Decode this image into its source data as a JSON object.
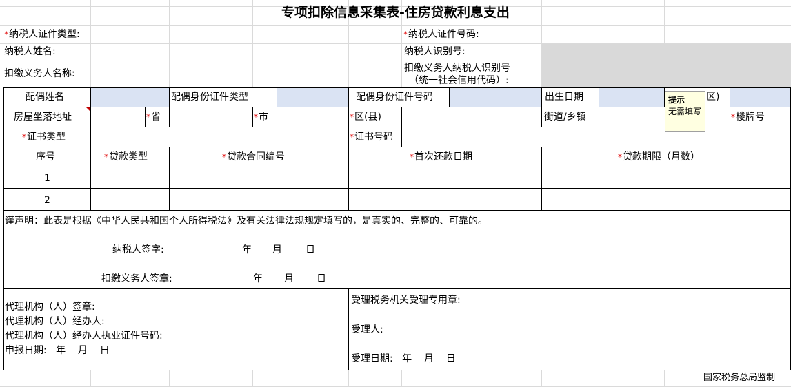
{
  "form": {
    "title": "专项扣除信息采集表-住房贷款利息支出",
    "req_mark": "*",
    "taxpayer_id_type_label": "纳税人证件类型:",
    "taxpayer_id_no_label": "纳税人证件号码:",
    "taxpayer_name_label": "纳税人姓名:",
    "taxpayer_tin_label": "纳税人识别号:",
    "withholder_name_label": "扣缴义务人名称:",
    "withholder_tin_label_1": "扣缴义务人纳税人识别号",
    "withholder_tin_label_2": "（统一社会信用代码）:",
    "spouse_name_label": "配偶姓名",
    "spouse_id_type_label": "配偶身份证件类型",
    "spouse_id_no_label": "配偶身份证件号码",
    "birth_date_label": "出生日期",
    "district_fragment": "区)",
    "house_address_label": "房屋坐落地址",
    "province_label": "省",
    "city_label": "市",
    "county_label": "区(县)",
    "street_label": "街道/乡镇",
    "building_label": "楼牌号",
    "cert_type_label": "证书类型",
    "cert_no_label": "证书号码",
    "loan_table": {
      "headers": [
        "序号",
        "贷款类型",
        "贷款合同编号",
        "首次还款日期",
        "贷款期限（月数）"
      ],
      "rows": [
        {
          "no": "1"
        },
        {
          "no": "2"
        }
      ]
    },
    "declaration": "谨声明：此表是根据《中华人民共和国个人所得税法》及有关法律法规规定填写的，是真实的、完整的、可靠的。",
    "taxpayer_sign_label": "纳税人签字:",
    "withholder_seal_label": "扣缴义务人签章:",
    "year": "年",
    "month": "月",
    "day": "日",
    "agent_seal_label": "代理机构（人）签章:",
    "agent_handler_label": "代理机构（人）经办人:",
    "agent_cert_label": "代理机构（人）经办人执业证件号码:",
    "report_date_label": "申报日期:",
    "tax_office_seal_label": "受理税务机关受理专用章:",
    "acceptor_label": "受理人:",
    "accept_date_label": "受理日期:",
    "footer": "国家税务总局监制"
  },
  "comment": {
    "title": "提示",
    "text": "无需填写"
  },
  "colors": {
    "input_fill": "#dae3f3",
    "readonly_fill": "#d9d9d9",
    "required_mark": "#e00000",
    "comment_fill": "#ffffe1"
  }
}
